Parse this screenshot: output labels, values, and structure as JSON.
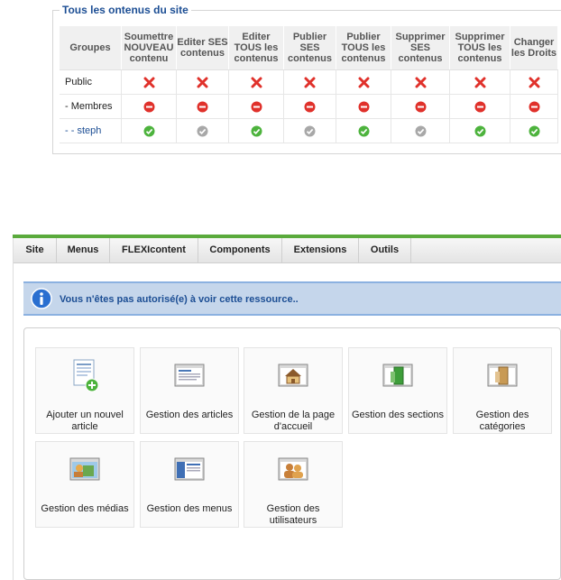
{
  "permissions": {
    "legend": "Tous les ontenus du site",
    "headers": [
      "Groupes",
      "Soumettre NOUVEAU contenu",
      "Editer SES contenus",
      "Editer TOUS les contenus",
      "Publier SES contenus",
      "Publier TOUS les contenus",
      "Supprimer SES contenus",
      "Supprimer TOUS les contenus",
      "Changer les Droits"
    ],
    "rows": [
      {
        "group": "Public",
        "cells": [
          "deny",
          "deny",
          "deny",
          "deny",
          "deny",
          "deny",
          "deny",
          "deny"
        ]
      },
      {
        "group": "- Membres",
        "cells": [
          "minus",
          "minus",
          "minus",
          "minus",
          "minus",
          "minus",
          "minus",
          "minus"
        ]
      },
      {
        "group": "- - steph",
        "cells": [
          "allow",
          "inherit",
          "allow",
          "inherit",
          "allow",
          "inherit",
          "allow",
          "allow"
        ]
      }
    ],
    "colors": {
      "deny": "#e0312b",
      "minus": "#e0312b",
      "allow": "#4db33d",
      "inherit": "#a8a8a8"
    }
  },
  "menubar": {
    "items": [
      "Site",
      "Menus",
      "FLEXIcontent",
      "Components",
      "Extensions",
      "Outils"
    ],
    "accent_color": "#5aaa3c"
  },
  "notice": {
    "icon": "info-icon",
    "text": "Vous n'êtes pas autorisé(e) à voir cette ressource.."
  },
  "control_panel": {
    "tiles": [
      {
        "label": "Ajouter un nouvel article",
        "icon": "add-article-icon"
      },
      {
        "label": "Gestion des articles",
        "icon": "articles-icon"
      },
      {
        "label": "Gestion de la page d'accueil",
        "icon": "frontpage-icon"
      },
      {
        "label": "Gestion des sections",
        "icon": "sections-icon"
      },
      {
        "label": "Gestion des catégories",
        "icon": "categories-icon"
      },
      {
        "label": "Gestion des médias",
        "icon": "media-icon"
      },
      {
        "label": "Gestion des menus",
        "icon": "menus-icon"
      },
      {
        "label": "Gestion des utilisateurs",
        "icon": "users-icon"
      }
    ]
  }
}
